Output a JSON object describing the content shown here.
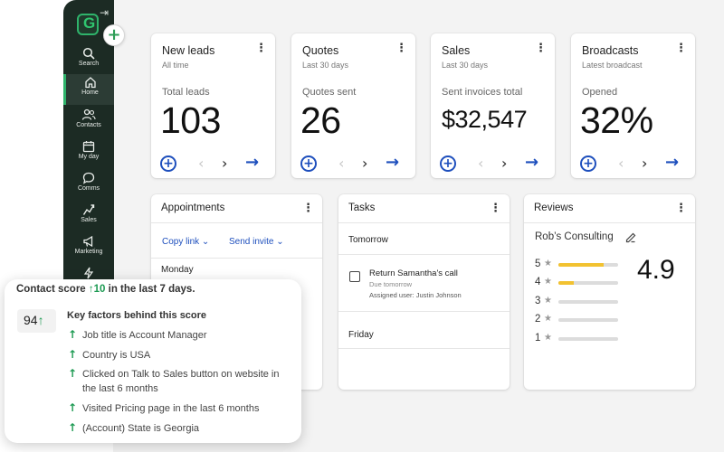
{
  "sidebar": {
    "logo_letter": "G",
    "collapse_icon": "collapse-right-icon",
    "add_icon": "plus-icon",
    "items": [
      {
        "label": "Search",
        "icon": "search-icon"
      },
      {
        "label": "Home",
        "icon": "home-icon",
        "active": true
      },
      {
        "label": "Contacts",
        "icon": "contacts-icon"
      },
      {
        "label": "My day",
        "icon": "calendar-icon"
      },
      {
        "label": "Comms",
        "icon": "chat-icon"
      },
      {
        "label": "Sales",
        "icon": "sales-icon"
      },
      {
        "label": "Marketing",
        "icon": "megaphone-icon"
      },
      {
        "label": "",
        "icon": "lightning-icon"
      }
    ],
    "accent": "#2fb36b",
    "background": "#1c2b24"
  },
  "kpis": [
    {
      "title": "New leads",
      "subtitle": "All time",
      "metric_label": "Total leads",
      "value": "103"
    },
    {
      "title": "Quotes",
      "subtitle": "Last 30 days",
      "metric_label": "Quotes sent",
      "value": "26"
    },
    {
      "title": "Sales",
      "subtitle": "Last 30 days",
      "metric_label": "Sent invoices total",
      "value": "$32,547"
    },
    {
      "title": "Broadcasts",
      "subtitle": "Latest broadcast",
      "metric_label": "Opened",
      "value": "32%"
    }
  ],
  "appointments": {
    "title": "Appointments",
    "copy_link": "Copy link",
    "send_invite": "Send invite",
    "day": "Monday"
  },
  "tasks": {
    "title": "Tasks",
    "group1": "Tomorrow",
    "task_title": "Return Samantha's call",
    "task_due": "Due tomorrow",
    "task_assigned": "Assigned user: Justin Johnson",
    "group2": "Friday"
  },
  "reviews": {
    "title": "Reviews",
    "business": "Rob’s Consulting",
    "rating": "4.9",
    "rows": [
      {
        "stars": "5",
        "fill": 0.75
      },
      {
        "stars": "4",
        "fill": 0.25
      },
      {
        "stars": "3",
        "fill": 0
      },
      {
        "stars": "2",
        "fill": 0
      },
      {
        "stars": "1",
        "fill": 0
      }
    ]
  },
  "score_popup": {
    "header_prefix": "Contact score",
    "header_delta": "10",
    "header_suffix": "in the last 7 days.",
    "score": "94",
    "factors_title": "Key factors behind this score",
    "factors": [
      "Job title is Account Manager",
      "Country is USA",
      "Clicked on Talk to Sales button on website in the last 6 months",
      "Visited Pricing page in the last 6 months",
      "(Account) State is Georgia"
    ],
    "positive_color": "#1c9a52"
  },
  "colors": {
    "link": "#1e4fbd",
    "star": "#f2c230"
  }
}
